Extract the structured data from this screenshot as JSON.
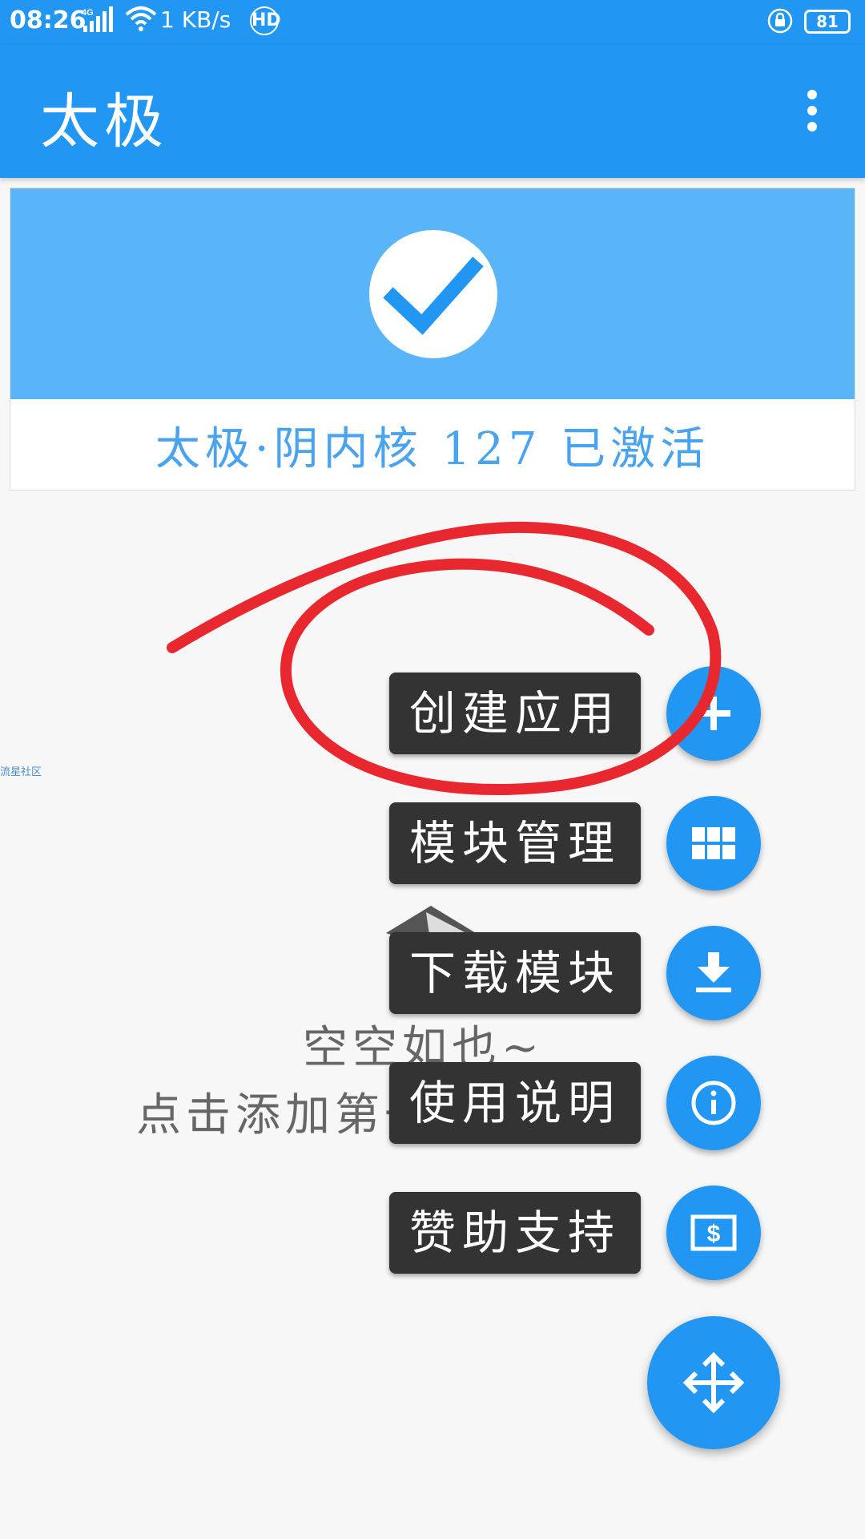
{
  "status_bar": {
    "time": "08:26",
    "network_speed": "1 KB/s",
    "network_type": "4G",
    "hd_label": "HD",
    "battery": "81"
  },
  "app_bar": {
    "title": "太极",
    "menu_icon": "more-vert-icon"
  },
  "status_card": {
    "icon": "check-icon",
    "text": "太极·阴内核 127 已激活"
  },
  "side_link": "流星社区",
  "empty_state": {
    "line1": "空空如也~",
    "line2": "点击添加第一个应用吧"
  },
  "fab_menu": {
    "items": [
      {
        "label": "创建应用",
        "icon": "plus-icon"
      },
      {
        "label": "模块管理",
        "icon": "grid-icon"
      },
      {
        "label": "下载模块",
        "icon": "download-icon"
      },
      {
        "label": "使用说明",
        "icon": "info-icon"
      },
      {
        "label": "赞助支持",
        "icon": "dollar-icon"
      }
    ],
    "main_icon": "move-arrows-icon"
  },
  "colors": {
    "primary": "#2196f3",
    "banner": "#5ab4f8",
    "status_text": "#4aa3ef",
    "annotation": "#e8272e",
    "menu_label_bg": "#333333"
  }
}
